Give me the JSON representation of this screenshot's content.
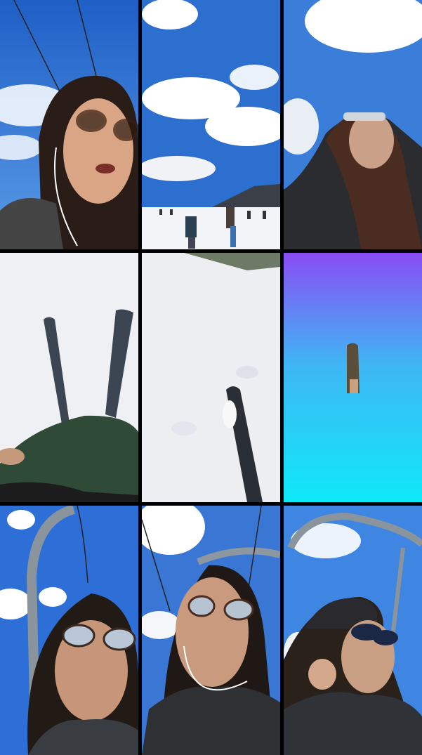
{
  "tiles": [
    {
      "id": 1,
      "scene": "selfie-woman-brown-glasses-earbuds-under-chairlift-cable",
      "palette": {
        "sky": "#2f6fd3",
        "hair": "#2a1d17"
      }
    },
    {
      "id": 2,
      "scene": "snowy-slope-with-skiers-and-clouds",
      "palette": {
        "sky": "#3b78d6",
        "snow": "#f2f4f8"
      }
    },
    {
      "id": 3,
      "scene": "woman-looking-up-sunglasses-black-puffer",
      "palette": {
        "sky": "#3a7ed9"
      }
    },
    {
      "id": 4,
      "scene": "pov-skis-on-snow-green-jacket",
      "palette": {
        "snow": "#eef0f3",
        "jacket": "#2f4a36"
      }
    },
    {
      "id": 5,
      "scene": "pov-single-ski-on-snow",
      "palette": {
        "snow": "#eceef2"
      }
    },
    {
      "id": 6,
      "scene": "gradient-purple-to-cyan-with-small-figure",
      "palette": {
        "top": "#8a4cf5",
        "bottom": "#0ee9f9"
      }
    },
    {
      "id": 7,
      "scene": "woman-blue-lens-glasses-on-chairlift",
      "palette": {
        "sky": "#2d6fd6"
      }
    },
    {
      "id": 8,
      "scene": "woman-glasses-earbuds-black-jacket-chairlift",
      "palette": {
        "sky": "#3a77d4"
      }
    },
    {
      "id": 9,
      "scene": "woman-beanie-sunglasses-touching-earbud-chairlift",
      "palette": {
        "sky": "#3f86e3"
      }
    }
  ]
}
